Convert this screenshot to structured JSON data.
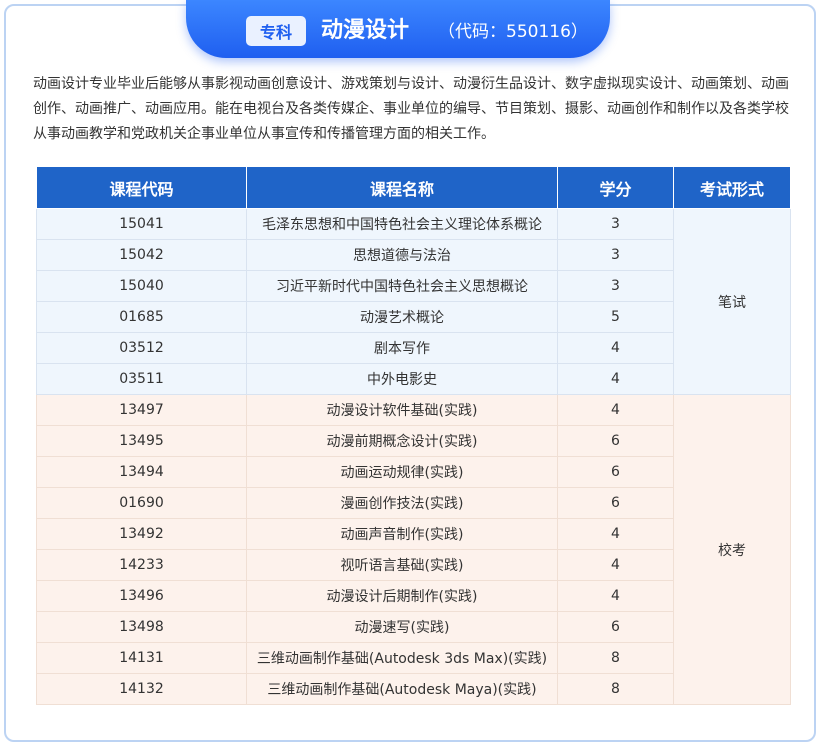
{
  "header": {
    "badge": "专科",
    "major_name": "动漫设计",
    "code_open": "（代码：",
    "code_value": "550116",
    "code_close": "）"
  },
  "description": "动画设计专业毕业后能够从事影视动画创意设计、游戏策划与设计、动漫衍生品设计、数字虚拟现实设计、动画策划、动画创作、动画推广、动画应用。能在电视台及各类传媒企、事业单位的编导、节目策划、摄影、动画创作和制作以及各类学校从事动画教学和党政机关企事业单位从事宣传和传播管理方面的相关工作。",
  "table": {
    "headers": [
      "课程代码",
      "课程名称",
      "学分",
      "考试形式"
    ],
    "groups": [
      {
        "mode": "笔试",
        "rows": [
          {
            "code": "15041",
            "name": "毛泽东思想和中国特色社会主义理论体系概论",
            "credit": "3"
          },
          {
            "code": "15042",
            "name": "思想道德与法治",
            "credit": "3"
          },
          {
            "code": "15040",
            "name": "习近平新时代中国特色社会主义思想概论",
            "credit": "3"
          },
          {
            "code": "01685",
            "name": "动漫艺术概论",
            "credit": "5"
          },
          {
            "code": "03512",
            "name": "剧本写作",
            "credit": "4"
          },
          {
            "code": "03511",
            "name": "中外电影史",
            "credit": "4"
          }
        ]
      },
      {
        "mode": "校考",
        "rows": [
          {
            "code": "13497",
            "name": "动漫设计软件基础(实践)",
            "credit": "4"
          },
          {
            "code": "13495",
            "name": "动漫前期概念设计(实践)",
            "credit": "6"
          },
          {
            "code": "13494",
            "name": "动画运动规律(实践)",
            "credit": "6"
          },
          {
            "code": "01690",
            "name": "漫画创作技法(实践)",
            "credit": "6"
          },
          {
            "code": "13492",
            "name": "动画声音制作(实践)",
            "credit": "4"
          },
          {
            "code": "14233",
            "name": "视听语言基础(实践)",
            "credit": "4"
          },
          {
            "code": "13496",
            "name": "动漫设计后期制作(实践)",
            "credit": "4"
          },
          {
            "code": "13498",
            "name": "动漫速写(实践)",
            "credit": "6"
          },
          {
            "code": "14131",
            "name": "三维动画制作基础(Autodesk 3ds Max)(实践)",
            "credit": "8"
          },
          {
            "code": "14132",
            "name": "三维动画制作基础(Autodesk Maya)(实践)",
            "credit": "8"
          }
        ]
      }
    ]
  },
  "colors": {
    "header_blue": "#1f5ff0",
    "table_header": "#1f64c8",
    "written_row_bg": "#eff6fd",
    "school_row_bg": "#fdf2ec",
    "border": "#bcd3f3"
  }
}
